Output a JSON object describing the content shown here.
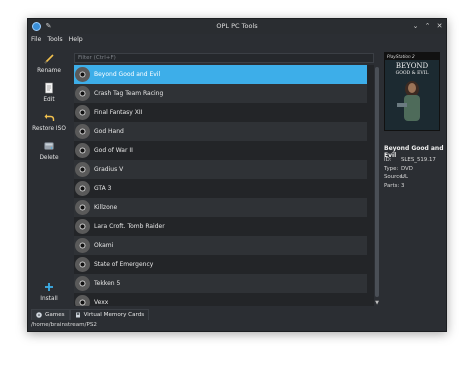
{
  "window": {
    "title": "OPL PC Tools"
  },
  "menu": [
    "File",
    "Tools",
    "Help"
  ],
  "toolbar": {
    "rename": "Rename",
    "edit": "Edit",
    "restore": "Restore ISO",
    "delete": "Delete",
    "install": "Install"
  },
  "filter": {
    "placeholder": "Filter (Ctrl+F)"
  },
  "games": [
    {
      "name": "Beyond Good and Evil",
      "selected": true
    },
    {
      "name": "Crash Tag Team Racing"
    },
    {
      "name": "Final Fantasy XII"
    },
    {
      "name": "God Hand"
    },
    {
      "name": "God of War II"
    },
    {
      "name": "Gradius V"
    },
    {
      "name": "GTA 3"
    },
    {
      "name": "Killzone"
    },
    {
      "name": "Lara Croft. Tomb Raider"
    },
    {
      "name": "Okami"
    },
    {
      "name": "State of Emergency"
    },
    {
      "name": "Tekken 5"
    },
    {
      "name": "Vexx"
    }
  ],
  "cover": {
    "platform": "PlayStation 2",
    "title_line1": "BEYOND",
    "title_line2": "GOOD & EVIL"
  },
  "details": {
    "title": "Beyond Good and Evil",
    "rows": [
      {
        "key": "ID:",
        "value": "SLES_519.17"
      },
      {
        "key": "Type:",
        "value": "DVD"
      },
      {
        "key": "Source:",
        "value": "UL"
      },
      {
        "key": "Parts:",
        "value": "3"
      }
    ]
  },
  "tabs": {
    "games": "Games",
    "memory_cards": "Virtual Memory Cards"
  },
  "status": {
    "path": "/home/brainstream/PS2"
  },
  "colors": {
    "window_bg": "#2b2e33",
    "selection": "#3daee9",
    "list_bg": "#232528"
  }
}
